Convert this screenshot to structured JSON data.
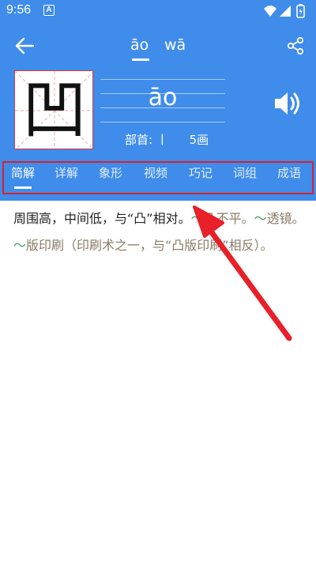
{
  "status_bar": {
    "time": "9:56",
    "notification_letter": "A",
    "icons": [
      "wifi-icon",
      "signal-icon",
      "battery-icon"
    ]
  },
  "header": {
    "back_icon": "arrow-left-icon",
    "pinyin_tabs": [
      "āo",
      "wā"
    ],
    "active_pinyin": 0,
    "share_icon": "share-icon"
  },
  "character": {
    "glyph": "凹",
    "pinyin": "āo",
    "radical_label": "部首:",
    "radical": "丨",
    "strokes": "5画",
    "speaker_icon": "speaker-icon"
  },
  "tabs": [
    {
      "label": "简解",
      "active": true
    },
    {
      "label": "详解",
      "active": false
    },
    {
      "label": "象形",
      "active": false
    },
    {
      "label": "视频",
      "active": false
    },
    {
      "label": "巧记",
      "active": false
    },
    {
      "label": "词组",
      "active": false
    },
    {
      "label": "成语",
      "active": false
    }
  ],
  "definition": {
    "main": "周围高，中间低，与“凸”相对。",
    "tilde1": "～",
    "example1": "凸不平。",
    "tilde2": "～",
    "example2": "透镜。",
    "tilde3": "～",
    "example3": "版印刷（印刷术之一，与“凸版印刷”相反）。"
  },
  "colors": {
    "primary": "#3F8CEA",
    "highlight_border": "#D9212B",
    "arrow": "#E8202A",
    "tilde": "#3C9A6A",
    "example": "#8A7A66"
  }
}
